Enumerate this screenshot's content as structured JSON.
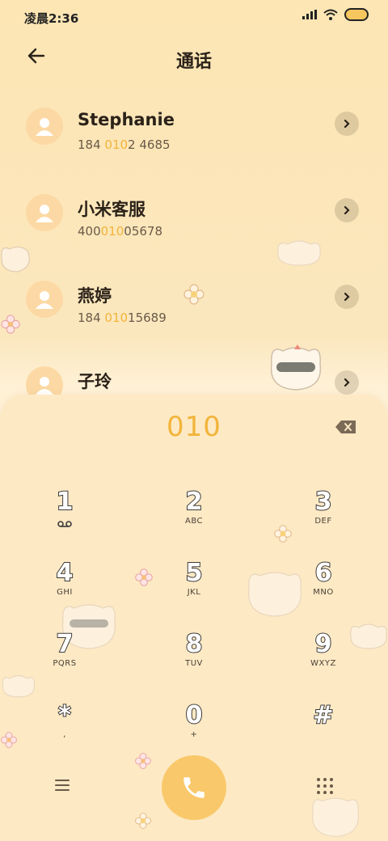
{
  "status_bar": {
    "time": "凌晨2:36"
  },
  "header": {
    "title": "通话"
  },
  "contacts": [
    {
      "name": "Stephanie",
      "number_pre": "184 ",
      "number_hl": "010",
      "number_post": "2 4685"
    },
    {
      "name": "小米客服",
      "number_pre": "400",
      "number_hl": "010",
      "number_post": "05678"
    },
    {
      "name": "燕婷",
      "number_pre": "184 ",
      "number_hl": "010",
      "number_post": "15689"
    },
    {
      "name": "子玲",
      "number_pre": "",
      "number_hl": "",
      "number_post": ""
    }
  ],
  "dialer": {
    "input": "010",
    "keys": [
      {
        "digit": "1",
        "letters": ""
      },
      {
        "digit": "2",
        "letters": "ABC"
      },
      {
        "digit": "3",
        "letters": "DEF"
      },
      {
        "digit": "4",
        "letters": "GHI"
      },
      {
        "digit": "5",
        "letters": "JKL"
      },
      {
        "digit": "6",
        "letters": "MNO"
      },
      {
        "digit": "7",
        "letters": "PQRS"
      },
      {
        "digit": "8",
        "letters": "TUV"
      },
      {
        "digit": "9",
        "letters": "WXYZ"
      },
      {
        "digit": "*",
        "letters": ","
      },
      {
        "digit": "0",
        "letters": "+"
      },
      {
        "digit": "#",
        "letters": ""
      }
    ]
  },
  "icons": {
    "back": "arrow-left-icon",
    "detail": "chevron-right-icon",
    "avatar": "person-icon",
    "backspace": "backspace-icon",
    "voicemail": "voicemail-icon",
    "menu": "menu-icon",
    "call": "phone-icon",
    "keypad": "dialpad-icon"
  },
  "colors": {
    "accent": "#f2b43a",
    "call_button": "#f9c86a",
    "avatar_bg": "#fcd9a4"
  }
}
